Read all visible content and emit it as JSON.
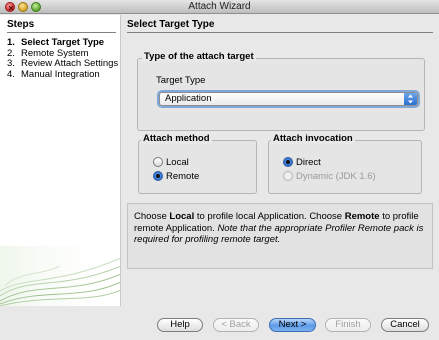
{
  "window": {
    "title": "Attach Wizard"
  },
  "steps": {
    "title": "Steps",
    "items": [
      {
        "num": "1.",
        "label": "Select Target Type"
      },
      {
        "num": "2.",
        "label": "Remote System"
      },
      {
        "num": "3.",
        "label": "Review Attach Settings"
      },
      {
        "num": "4.",
        "label": "Manual Integration"
      }
    ],
    "current_index": 0
  },
  "main": {
    "title": "Select Target Type",
    "target_group": {
      "title": "Type of the attach target",
      "label": "Target Type",
      "selected": "Application"
    },
    "method_group": {
      "title": "Attach method",
      "options": [
        {
          "label": "Local",
          "checked": false
        },
        {
          "label": "Remote",
          "checked": true
        }
      ]
    },
    "invocation_group": {
      "title": "Attach invocation",
      "options": [
        {
          "label": "Direct",
          "checked": true,
          "enabled": true
        },
        {
          "label": "Dynamic (JDK 1.6)",
          "checked": false,
          "enabled": false
        }
      ]
    },
    "info": {
      "p1_a": "Choose ",
      "p1_b": "Local",
      "p1_c": " to profile local Application. Choose ",
      "p1_d": "Remote",
      "p1_e": " to profile remote Application. ",
      "p1_f": "Note that the appropriate Profiler Remote pack is required for profiling remote target."
    }
  },
  "buttons": {
    "help": "Help",
    "back": "< Back",
    "next": "Next >",
    "finish": "Finish",
    "cancel": "Cancel"
  },
  "colors": {
    "accent": "#5d9be8",
    "window_bg": "#e8e8e8"
  }
}
